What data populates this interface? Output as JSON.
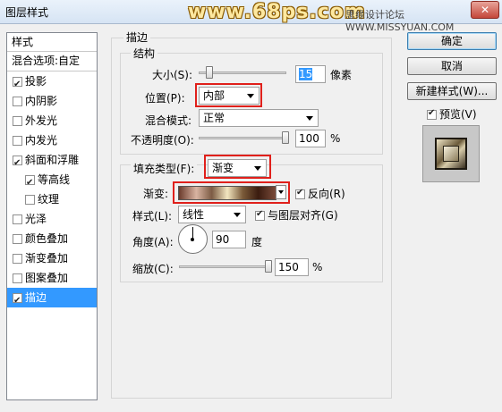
{
  "window": {
    "title": "图层样式",
    "watermark": "www.68ps.com",
    "watermark_right": "思缘设计论坛 WWW.MISSYUAN.COM",
    "close_label": "✕"
  },
  "sidebar": {
    "header": "样式",
    "blend_options": "混合选项:自定",
    "items": [
      {
        "label": "投影",
        "checked": true
      },
      {
        "label": "内阴影",
        "checked": false
      },
      {
        "label": "外发光",
        "checked": false
      },
      {
        "label": "内发光",
        "checked": false
      },
      {
        "label": "斜面和浮雕",
        "checked": true
      },
      {
        "label": "等高线",
        "checked": true
      },
      {
        "label": "纹理",
        "checked": false
      },
      {
        "label": "光泽",
        "checked": false
      },
      {
        "label": "颜色叠加",
        "checked": false
      },
      {
        "label": "渐变叠加",
        "checked": false
      },
      {
        "label": "图案叠加",
        "checked": false
      },
      {
        "label": "描边",
        "checked": true
      }
    ]
  },
  "stroke": {
    "section_title": "描边",
    "structure_title": "结构",
    "size_label": "大小(S):",
    "size_value": "15",
    "size_unit": "像素",
    "position_label": "位置(P):",
    "position_value": "内部",
    "blend_mode_label": "混合模式:",
    "blend_mode_value": "正常",
    "opacity_label": "不透明度(O):",
    "opacity_value": "100",
    "opacity_unit": "%",
    "fill_type_label": "填充类型(F):",
    "fill_type_value": "渐变",
    "gradient_label": "渐变:",
    "reverse_label": "反向(R)",
    "reverse_checked": true,
    "style_label": "样式(L):",
    "style_value": "线性",
    "align_label": "与图层对齐(G)",
    "align_checked": true,
    "angle_label": "角度(A):",
    "angle_value": "90",
    "angle_unit": "度",
    "scale_label": "缩放(C):",
    "scale_value": "150",
    "scale_unit": "%"
  },
  "buttons": {
    "ok": "确定",
    "cancel": "取消",
    "new_style": "新建样式(W)...",
    "preview_label": "预览(V)",
    "preview_checked": true
  }
}
